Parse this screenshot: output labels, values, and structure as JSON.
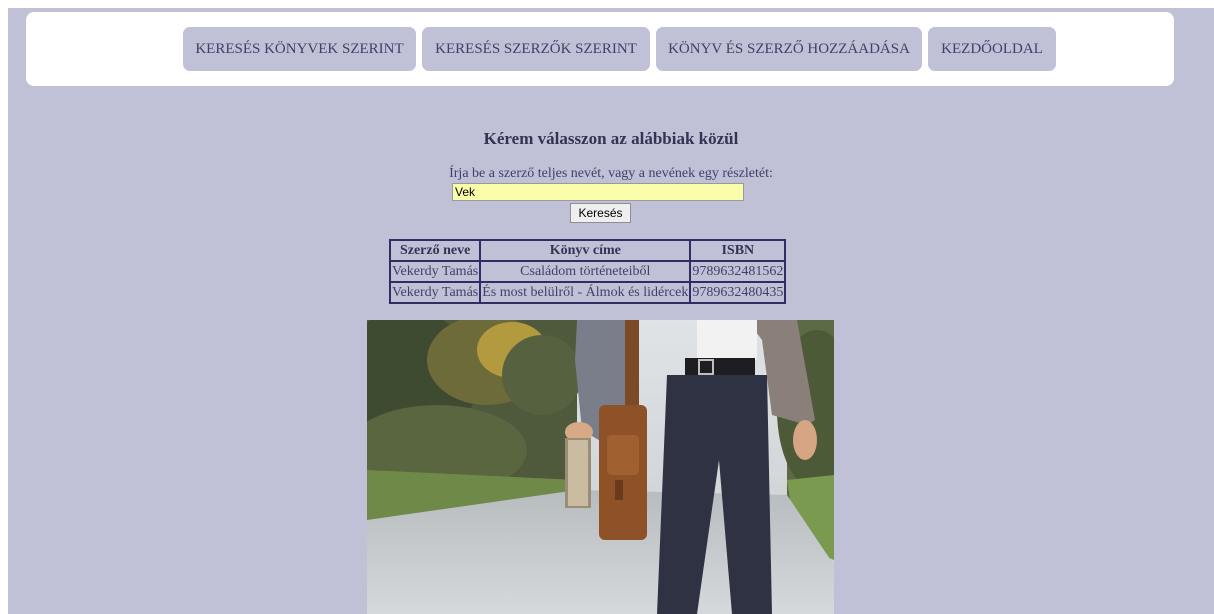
{
  "nav": {
    "items": [
      {
        "label": "KERESÉS KÖNYVEK SZERINT"
      },
      {
        "label": "KERESÉS SZERZŐK SZERINT"
      },
      {
        "label": "KÖNYV ÉS SZERZŐ HOZZÁADÁSA"
      },
      {
        "label": "KEZDŐOLDAL"
      }
    ]
  },
  "main": {
    "heading": "Kérem válasszon az alábbiak közül",
    "prompt": "Írja be a szerző teljes nevét, vagy a nevének egy részletét:",
    "search": {
      "value": "Vek",
      "button_label": "Keresés"
    },
    "table": {
      "headers": [
        "Szerző neve",
        "Könyv címe",
        "ISBN"
      ],
      "rows": [
        [
          "Vekerdy Tamás",
          "Családom történeteiből",
          "9789632481562"
        ],
        [
          "Vekerdy Tamás",
          "És most belülről - Álmok és lidércek",
          "9789632480435"
        ]
      ]
    }
  },
  "colors": {
    "page_background": "#c0c1d6",
    "nav_background": "#ffffff",
    "button_background": "#c0c1d6",
    "text": "#404068",
    "table_border": "#2e2e62",
    "input_background": "#fafdaa"
  }
}
